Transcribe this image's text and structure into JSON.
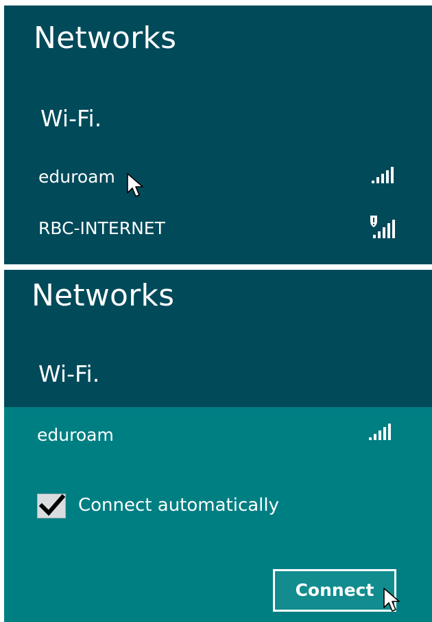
{
  "top_panel": {
    "title": "Networks",
    "section": "Wi-Fi.",
    "networks": [
      {
        "name": "eduroam",
        "icon": "wifi-signal-icon",
        "secured_warning": false
      },
      {
        "name": "RBC-INTERNET",
        "icon": "wifi-signal-warning-icon",
        "secured_warning": true
      }
    ]
  },
  "bottom_panel": {
    "title": "Networks",
    "section": "Wi-Fi.",
    "selected_network": {
      "name": "eduroam",
      "icon": "wifi-signal-icon",
      "connect_automatically_label": "Connect automatically",
      "connect_automatically_checked": true,
      "connect_button_label": "Connect"
    }
  },
  "colors": {
    "panel_bg": "#004a5a",
    "selected_bg": "#007f83",
    "text": "#ffffff",
    "checkbox_bg": "#d9dde0"
  }
}
